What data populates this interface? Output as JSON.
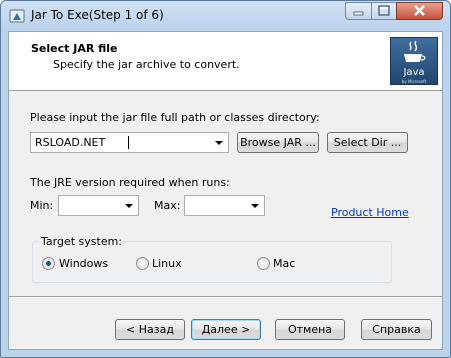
{
  "window": {
    "title": "Jar To Exe(Step 1 of 6)"
  },
  "header": {
    "title": "Select JAR file",
    "subtitle": "Specify the jar archive to convert.",
    "logo_text": "Java",
    "logo_small": "by Microsoft"
  },
  "jar": {
    "prompt": "Please input the jar file full path or classes directory:",
    "value": "RSLOAD.NET",
    "browse_label": "Browse JAR ...",
    "select_dir_label": "Select Dir ..."
  },
  "jre": {
    "prompt": "The JRE version required when runs:",
    "min_label": "Min:",
    "max_label": "Max:",
    "min_value": "",
    "max_value": "",
    "product_home_link": "Product Home"
  },
  "target": {
    "label": "Target system:",
    "options": [
      {
        "label": "Windows",
        "selected": true
      },
      {
        "label": "Linux",
        "selected": false
      },
      {
        "label": "Mac",
        "selected": false
      }
    ]
  },
  "footer": {
    "back_label": "< Назад",
    "next_label": "Далее >",
    "cancel_label": "Отмена",
    "help_label": "Справка"
  }
}
